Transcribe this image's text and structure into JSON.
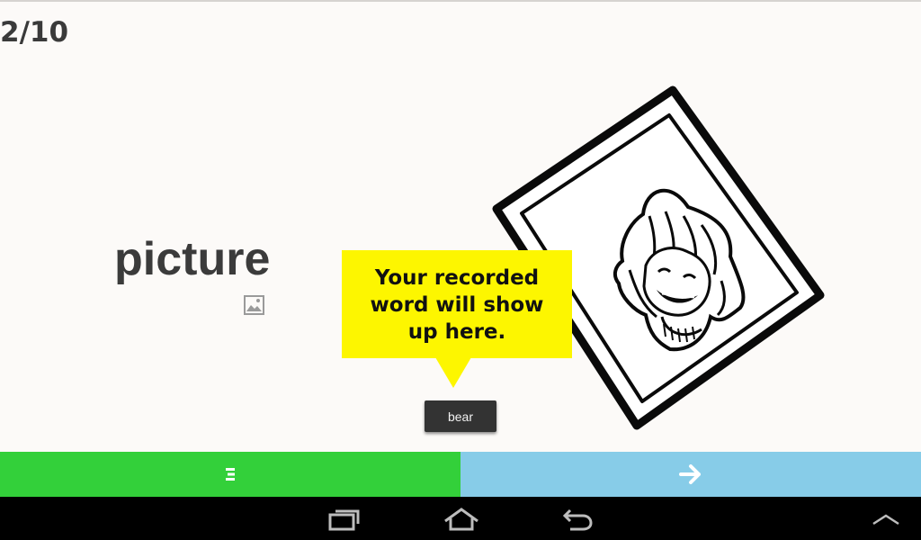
{
  "progress": {
    "current": "2/10"
  },
  "card": {
    "word": "picture",
    "word_icon": "image-icon",
    "illustration": "photo-of-smiling-girl"
  },
  "tooltip": {
    "text_line1": "Your recorded",
    "text_line2": "word will show",
    "text_line3": "up here."
  },
  "recorded_word": {
    "value": "bear"
  },
  "bottom_bar": {
    "menu_icon": "menu-icon",
    "menu_color": "#33d03a",
    "next_icon": "arrow-right-icon",
    "next_color": "#87cce8"
  },
  "system_nav": {
    "recents_icon": "recent-apps-icon",
    "home_icon": "home-icon",
    "back_icon": "back-icon",
    "up_icon": "chevron-up-icon"
  }
}
